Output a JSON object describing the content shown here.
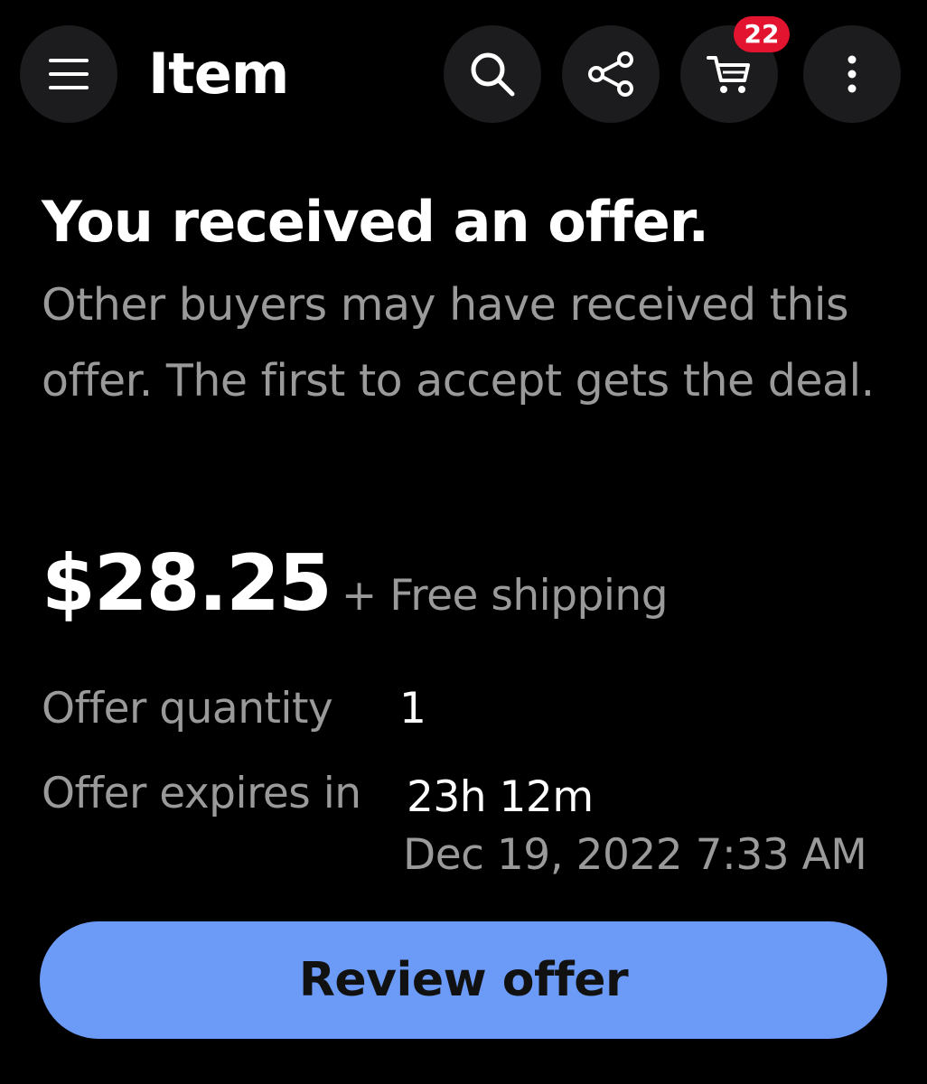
{
  "header": {
    "title": "Item",
    "icons": {
      "menu": "hamburger-menu-icon",
      "search": "search-icon",
      "share": "share-icon",
      "cart": "cart-icon",
      "more": "more-vertical-icon"
    },
    "cart_count": "22"
  },
  "offer": {
    "title": "You received an offer.",
    "description": "Other buyers may have received this offer. The first to accept gets the deal.",
    "price": "$28.25",
    "shipping": "+ Free shipping",
    "quantity_label": "Offer quantity",
    "quantity_value": "1",
    "expires_label": "Offer expires in",
    "expires_duration": "23h 12m",
    "expires_date": "Dec 19, 2022 7:33 AM"
  },
  "actions": {
    "review_label": "Review offer"
  },
  "colors": {
    "background": "#000000",
    "button_background": "#1c1c1e",
    "badge": "#e3142f",
    "primary_button": "#6b9bf6",
    "secondary_text": "#9a9a9a"
  }
}
